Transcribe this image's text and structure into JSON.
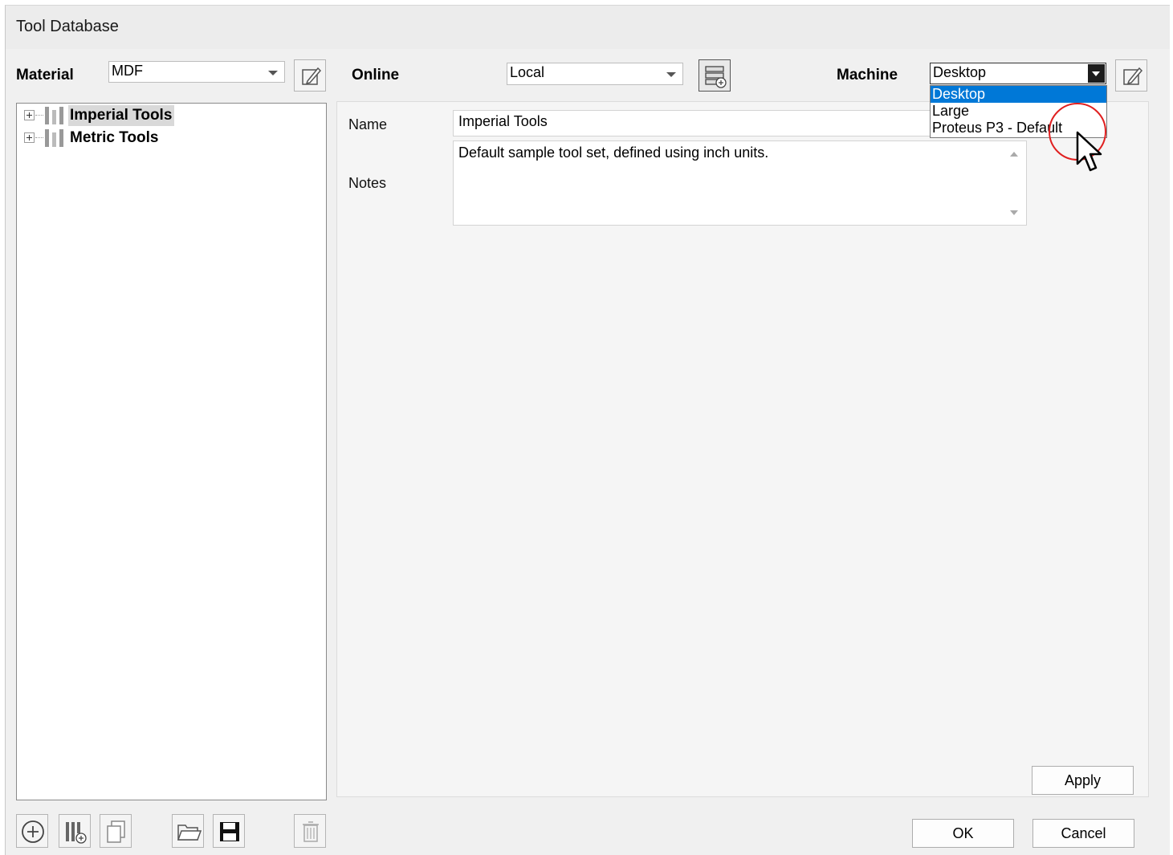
{
  "window": {
    "title": "Tool Database"
  },
  "toolbar": {
    "material_label": "Material",
    "material_value": "MDF",
    "online_label": "Online",
    "online_value": "Local",
    "machine_label": "Machine",
    "machine_value": "Desktop"
  },
  "machine_dropdown": {
    "options": [
      "Desktop",
      "Large",
      "Proteus P3 - Default"
    ],
    "selected_index": 0
  },
  "tree": {
    "items": [
      {
        "label": "Imperial Tools",
        "selected": true
      },
      {
        "label": "Metric Tools",
        "selected": false
      }
    ]
  },
  "details": {
    "name_label": "Name",
    "name_value": "Imperial Tools",
    "notes_label": "Notes",
    "notes_value": "Default sample tool set, defined using inch units."
  },
  "buttons": {
    "apply": "Apply",
    "ok": "OK",
    "cancel": "Cancel"
  },
  "icons": {
    "material_edit": "edit-icon",
    "online_add": "database-add-icon",
    "machine_edit": "edit-icon",
    "tree_item": "tool-group-icon",
    "bottom": [
      "add-circle-icon",
      "add-tool-icon",
      "copy-icon",
      "folder-open-icon",
      "save-icon",
      "trash-icon"
    ]
  },
  "colors": {
    "selection": "#0078d7",
    "highlight_ring": "#e02020"
  }
}
